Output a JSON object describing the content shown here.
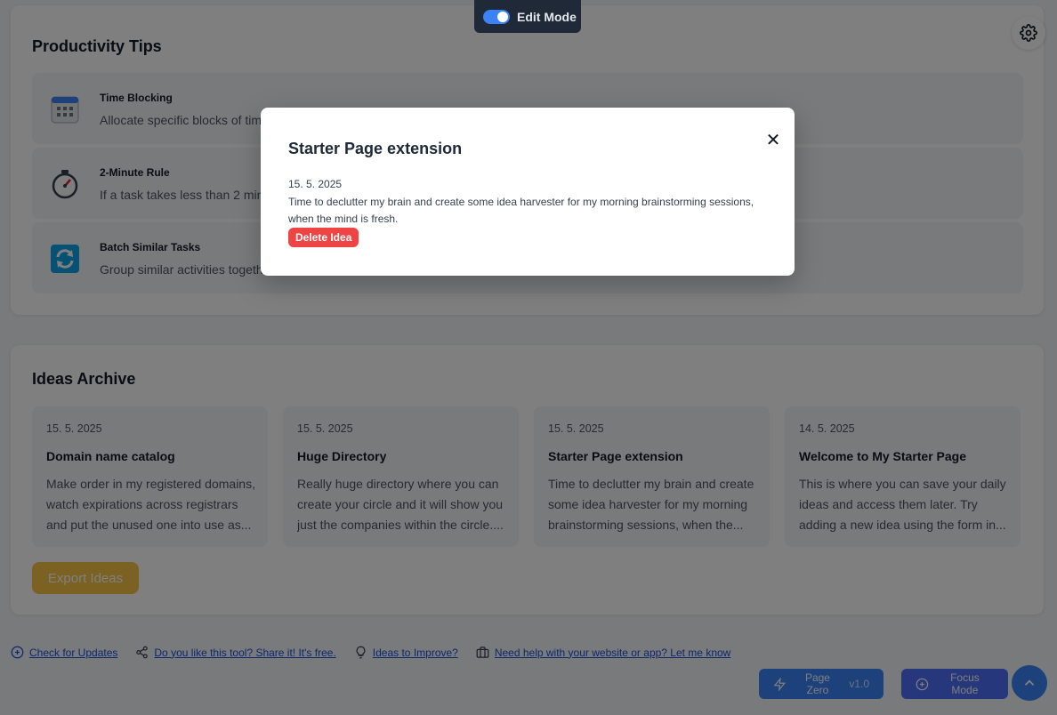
{
  "edit_mode": {
    "label": "Edit Mode",
    "enabled": true
  },
  "settings": {
    "icon": "gear-icon"
  },
  "tips": {
    "title": "Productivity Tips",
    "items": [
      {
        "title": "Time Blocking",
        "desc": "Allocate specific blocks of tim",
        "icon": "calendar-icon"
      },
      {
        "title": "2-Minute Rule",
        "desc": "If a task takes less than 2 min",
        "icon": "stopwatch-icon"
      },
      {
        "title": "Batch Similar Tasks",
        "desc": "Group similar activities togeth",
        "icon": "refresh-icon"
      }
    ]
  },
  "archive": {
    "title": "Ideas Archive",
    "ideas": [
      {
        "date": "15. 5. 2025",
        "title": "Domain name catalog",
        "desc": "Make order in my registered domains, watch expirations across registrars and put the unused one into use as..."
      },
      {
        "date": "15. 5. 2025",
        "title": "Huge Directory",
        "desc": "Really huge directory where you can create your circle and it will show you just the companies within the circle...."
      },
      {
        "date": "15. 5. 2025",
        "title": "Starter Page extension",
        "desc": "Time to declutter my brain and create some idea harvester for my morning brainstorming sessions, when the..."
      },
      {
        "date": "14. 5. 2025",
        "title": "Welcome to My Starter Page",
        "desc": "This is where you can save your daily ideas and access them later. Try adding a new idea using the form in..."
      }
    ],
    "export_label": "Export Ideas"
  },
  "footer": {
    "links": [
      {
        "label": "Check for Updates",
        "icon": "plus-circle-icon"
      },
      {
        "label": "Do you like this tool? Share it! It's free.",
        "icon": "share-icon"
      },
      {
        "label": "Ideas to Improve?",
        "icon": "lightbulb-icon"
      },
      {
        "label": "Need help with your website or app? Let me know",
        "icon": "briefcase-icon"
      }
    ]
  },
  "bottom": {
    "page_zero_label": "Page Zero",
    "page_zero_version": "v1.0",
    "focus_label": "Focus Mode"
  },
  "modal": {
    "title": "Starter Page extension",
    "date": "15. 5. 2025",
    "text": "Time to declutter my brain and create some idea harvester for my morning brainstorming sessions, when the mind is fresh.",
    "delete_label": "Delete Idea",
    "close_symbol": "✕"
  },
  "colors": {
    "accent": "#3b82f6",
    "danger": "#ef4444",
    "export": "#f6c445"
  }
}
